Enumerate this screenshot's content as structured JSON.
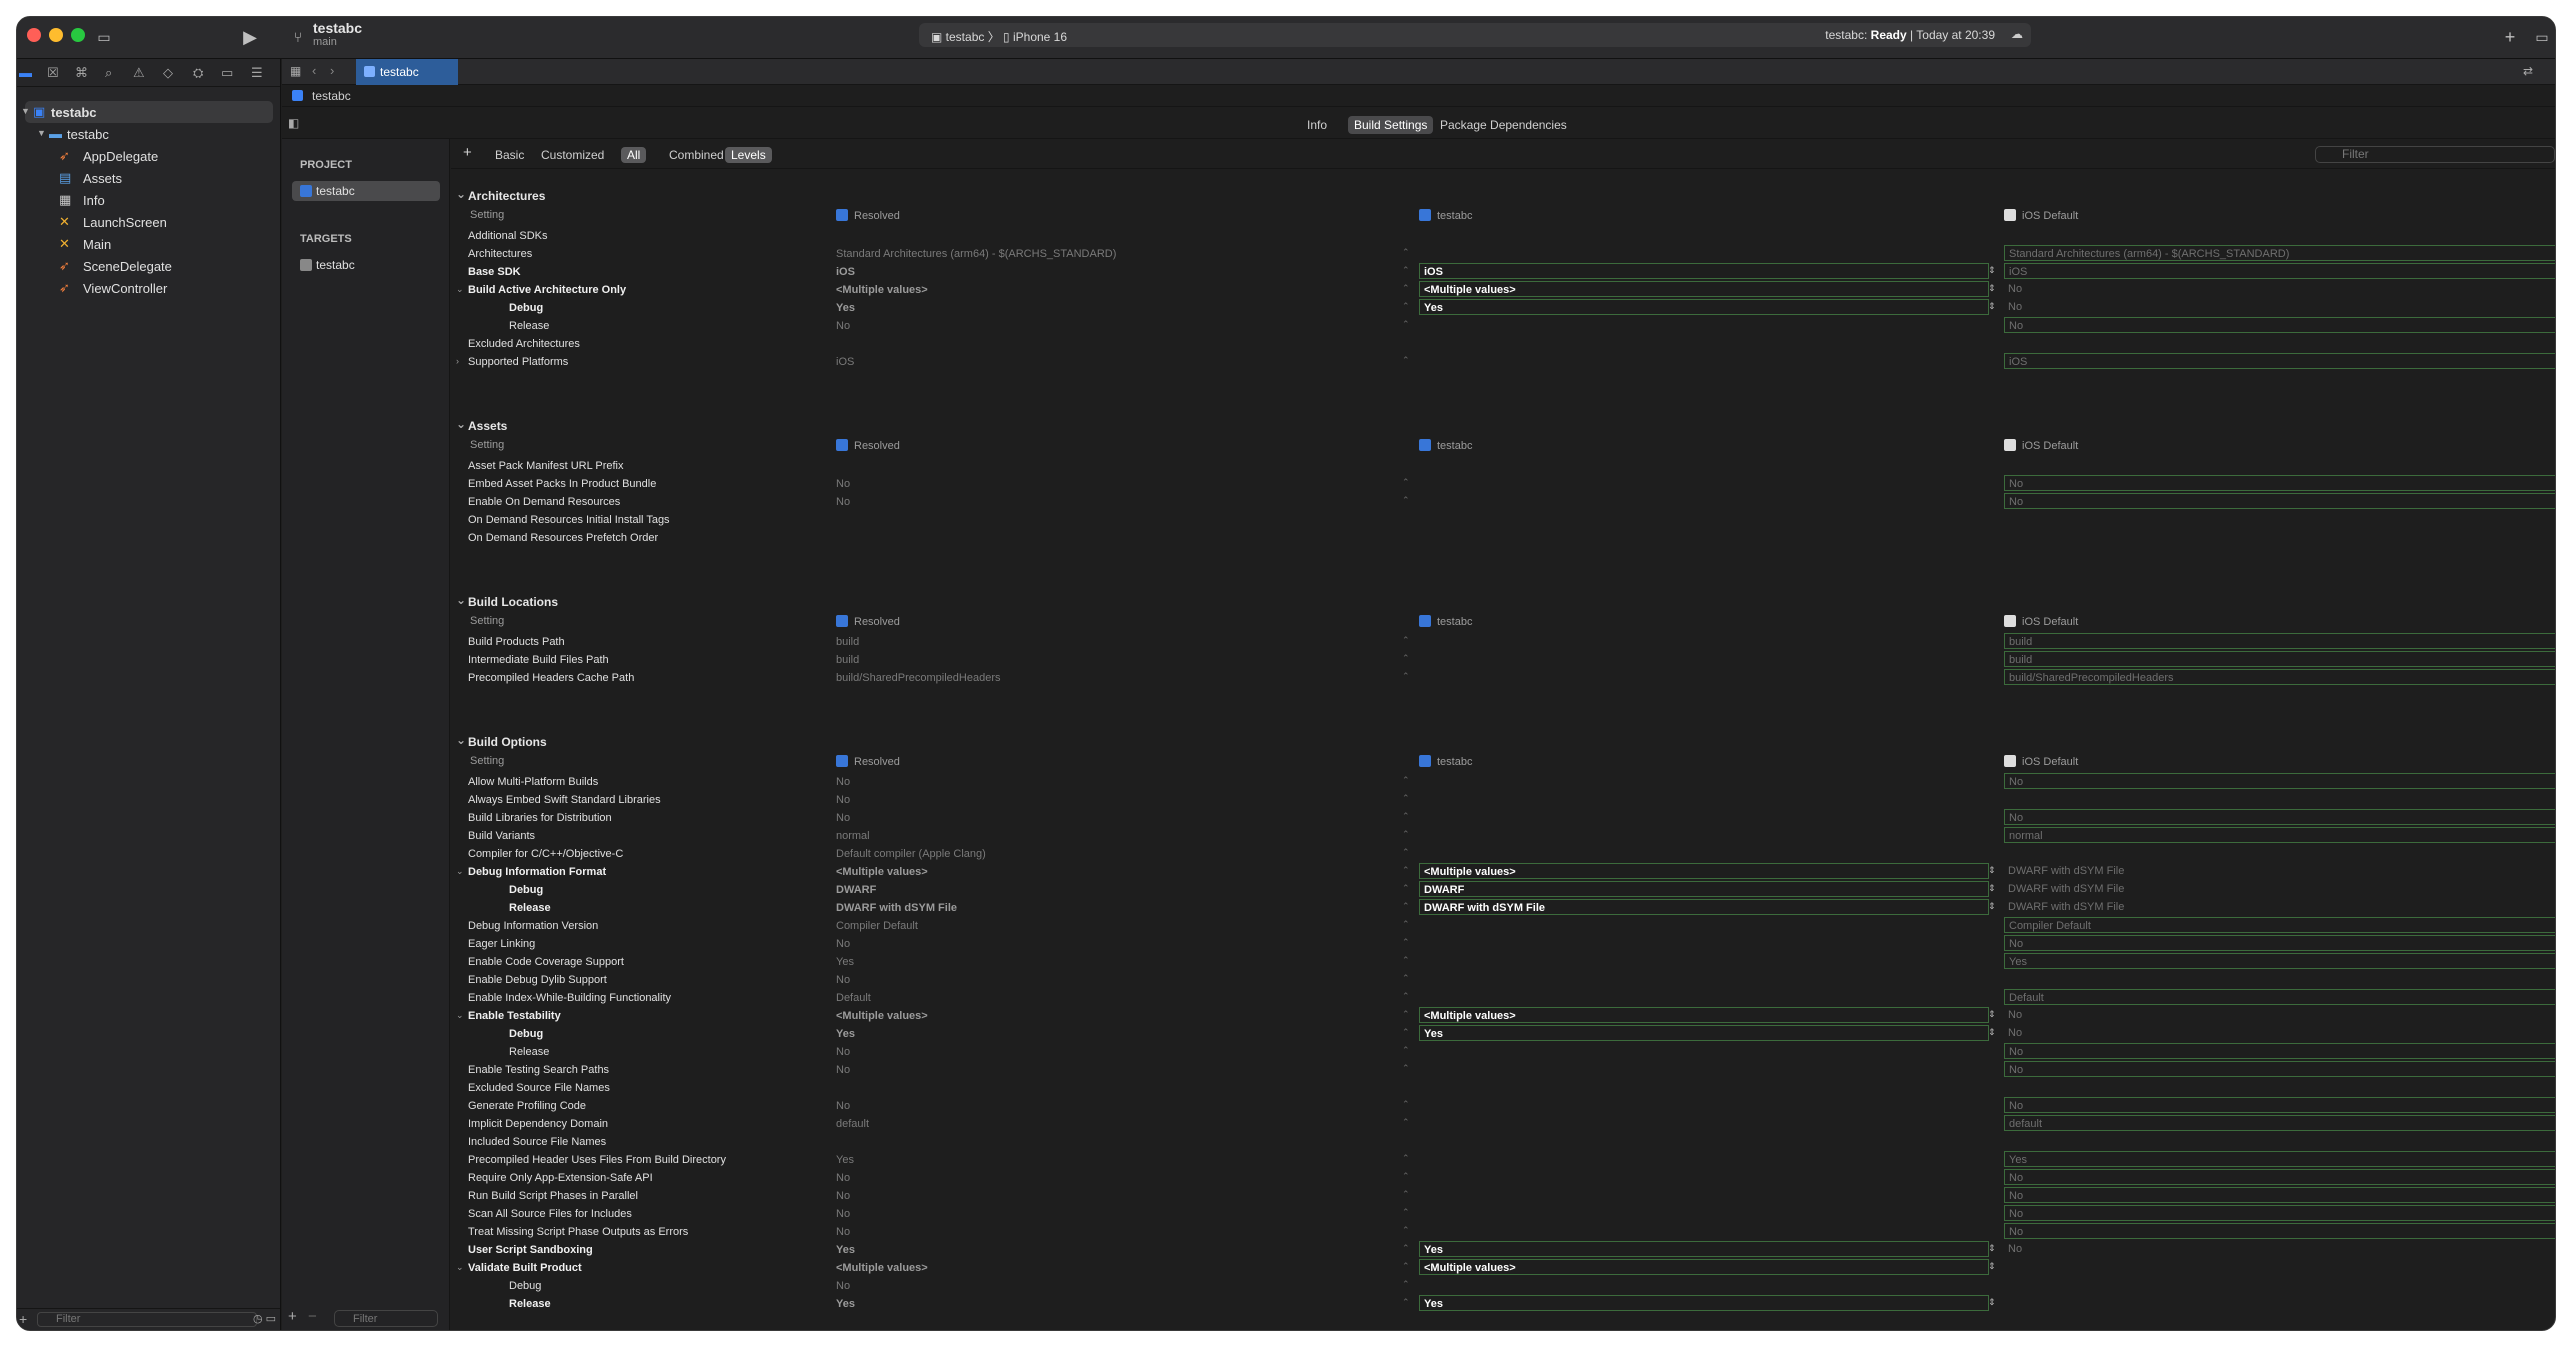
{
  "window": {
    "scheme_title": "testabc",
    "branch": "main",
    "destination_scheme": "testabc",
    "destination_device": "iPhone 16",
    "status_prefix": "testabc:",
    "status_state": "Ready",
    "status_time": "Today at 20:39"
  },
  "navigator": {
    "items": [
      {
        "label": "testabc",
        "icon": "project-icon"
      },
      {
        "label": "testabc",
        "icon": "folder-icon"
      },
      {
        "label": "AppDelegate",
        "icon": "swift-icon"
      },
      {
        "label": "Assets",
        "icon": "assets-icon"
      },
      {
        "label": "Info",
        "icon": "plist-icon"
      },
      {
        "label": "LaunchScreen",
        "icon": "storyboard-icon"
      },
      {
        "label": "Main",
        "icon": "storyboard-icon"
      },
      {
        "label": "SceneDelegate",
        "icon": "swift-icon"
      },
      {
        "label": "ViewController",
        "icon": "swift-icon"
      }
    ],
    "filter_placeholder": "Filter"
  },
  "editor": {
    "tab_label": "testabc",
    "jump_label": "testabc",
    "top_tabs": [
      "Info",
      "Build Settings",
      "Package Dependencies"
    ],
    "project_header": "PROJECT",
    "project_item": "testabc",
    "targets_header": "TARGETS",
    "target_item": "testabc",
    "list_filter_placeholder": "Filter"
  },
  "filterbar": {
    "add": "+",
    "buttons": [
      "Basic",
      "Customized",
      "All",
      "Combined",
      "Levels"
    ],
    "search_placeholder": "Filter"
  },
  "columns": {
    "setting": "Setting",
    "resolved": "Resolved",
    "target": "testabc",
    "default": "iOS Default"
  },
  "sections": [
    {
      "title": "Architectures",
      "rows": [
        {
          "name": "Additional SDKs",
          "resolved": "",
          "target": "",
          "default": ""
        },
        {
          "name": "Architectures",
          "resolved": "Standard Architectures (arm64)  -  $(ARCHS_STANDARD)",
          "target": "",
          "default": "Standard Architectures (arm64)  -  $(ARCHS_STANDARD)"
        },
        {
          "name": "Base SDK",
          "resolved": "iOS",
          "target": "iOS",
          "default": "iOS",
          "bold": true
        },
        {
          "name": "Build Active Architecture Only",
          "resolved": "<Multiple values>",
          "target": "<Multiple values>",
          "default": "No",
          "bold": true,
          "expanded": true
        },
        {
          "name": "Debug",
          "resolved": "Yes",
          "target": "Yes",
          "default": "No",
          "indent": true,
          "bold": true
        },
        {
          "name": "Release",
          "resolved": "No",
          "target": "",
          "default": "No",
          "indent": true
        },
        {
          "name": "Excluded Architectures",
          "resolved": "",
          "target": "",
          "default": ""
        },
        {
          "name": "Supported Platforms",
          "resolved": "iOS",
          "target": "",
          "default": "iOS",
          "collapsed": true
        }
      ]
    },
    {
      "title": "Assets",
      "rows": [
        {
          "name": "Asset Pack Manifest URL Prefix",
          "resolved": "",
          "target": "",
          "default": ""
        },
        {
          "name": "Embed Asset Packs In Product Bundle",
          "resolved": "No",
          "target": "",
          "default": "No"
        },
        {
          "name": "Enable On Demand Resources",
          "resolved": "No",
          "target": "",
          "default": "No"
        },
        {
          "name": "On Demand Resources Initial Install Tags",
          "resolved": "",
          "target": "",
          "default": ""
        },
        {
          "name": "On Demand Resources Prefetch Order",
          "resolved": "",
          "target": "",
          "default": ""
        }
      ]
    },
    {
      "title": "Build Locations",
      "rows": [
        {
          "name": "Build Products Path",
          "resolved": "build",
          "target": "",
          "default": "build"
        },
        {
          "name": "Intermediate Build Files Path",
          "resolved": "build",
          "target": "",
          "default": "build"
        },
        {
          "name": "Precompiled Headers Cache Path",
          "resolved": "build/SharedPrecompiledHeaders",
          "target": "",
          "default": "build/SharedPrecompiledHeaders"
        }
      ]
    },
    {
      "title": "Build Options",
      "rows": [
        {
          "name": "Allow Multi-Platform Builds",
          "resolved": "No",
          "target": "",
          "default": "No"
        },
        {
          "name": "Always Embed Swift Standard Libraries",
          "resolved": "No",
          "target": "",
          "default": ""
        },
        {
          "name": "Build Libraries for Distribution",
          "resolved": "No",
          "target": "",
          "default": "No"
        },
        {
          "name": "Build Variants",
          "resolved": "normal",
          "target": "",
          "default": "normal"
        },
        {
          "name": "Compiler for C/C++/Objective-C",
          "resolved": "Default compiler (Apple Clang)",
          "target": "",
          "default": ""
        },
        {
          "name": "Debug Information Format",
          "resolved": "<Multiple values>",
          "target": "<Multiple values>",
          "default": "DWARF with dSYM File",
          "bold": true,
          "expanded": true
        },
        {
          "name": "Debug",
          "resolved": "DWARF",
          "target": "DWARF",
          "default": "DWARF with dSYM File",
          "indent": true,
          "bold": true
        },
        {
          "name": "Release",
          "resolved": "DWARF with dSYM File",
          "target": "DWARF with dSYM File",
          "default": "DWARF with dSYM File",
          "indent": true,
          "bold": true
        },
        {
          "name": "Debug Information Version",
          "resolved": "Compiler Default",
          "target": "",
          "default": "Compiler Default"
        },
        {
          "name": "Eager Linking",
          "resolved": "No",
          "target": "",
          "default": "No"
        },
        {
          "name": "Enable Code Coverage Support",
          "resolved": "Yes",
          "target": "",
          "default": "Yes"
        },
        {
          "name": "Enable Debug Dylib Support",
          "resolved": "No",
          "target": "",
          "default": ""
        },
        {
          "name": "Enable Index-While-Building Functionality",
          "resolved": "Default",
          "target": "",
          "default": "Default"
        },
        {
          "name": "Enable Testability",
          "resolved": "<Multiple values>",
          "target": "<Multiple values>",
          "default": "No",
          "bold": true,
          "expanded": true
        },
        {
          "name": "Debug",
          "resolved": "Yes",
          "target": "Yes",
          "default": "No",
          "indent": true,
          "bold": true
        },
        {
          "name": "Release",
          "resolved": "No",
          "target": "",
          "default": "No",
          "indent": true
        },
        {
          "name": "Enable Testing Search Paths",
          "resolved": "No",
          "target": "",
          "default": "No"
        },
        {
          "name": "Excluded Source File Names",
          "resolved": "",
          "target": "",
          "default": ""
        },
        {
          "name": "Generate Profiling Code",
          "resolved": "No",
          "target": "",
          "default": "No"
        },
        {
          "name": "Implicit Dependency Domain",
          "resolved": "default",
          "target": "",
          "default": "default"
        },
        {
          "name": "Included Source File Names",
          "resolved": "",
          "target": "",
          "default": ""
        },
        {
          "name": "Precompiled Header Uses Files From Build Directory",
          "resolved": "Yes",
          "target": "",
          "default": "Yes"
        },
        {
          "name": "Require Only App-Extension-Safe API",
          "resolved": "No",
          "target": "",
          "default": "No"
        },
        {
          "name": "Run Build Script Phases in Parallel",
          "resolved": "No",
          "target": "",
          "default": "No"
        },
        {
          "name": "Scan All Source Files for Includes",
          "resolved": "No",
          "target": "",
          "default": "No"
        },
        {
          "name": "Treat Missing Script Phase Outputs as Errors",
          "resolved": "No",
          "target": "",
          "default": "No"
        },
        {
          "name": "User Script Sandboxing",
          "resolved": "Yes",
          "target": "Yes",
          "default": "No",
          "bold": true
        },
        {
          "name": "Validate Built Product",
          "resolved": "<Multiple values>",
          "target": "<Multiple values>",
          "default": "",
          "bold": true,
          "expanded": true
        },
        {
          "name": "Debug",
          "resolved": "No",
          "target": "",
          "default": "",
          "indent": true
        },
        {
          "name": "Release",
          "resolved": "Yes",
          "target": "Yes",
          "default": "",
          "indent": true,
          "bold": true
        }
      ]
    }
  ]
}
